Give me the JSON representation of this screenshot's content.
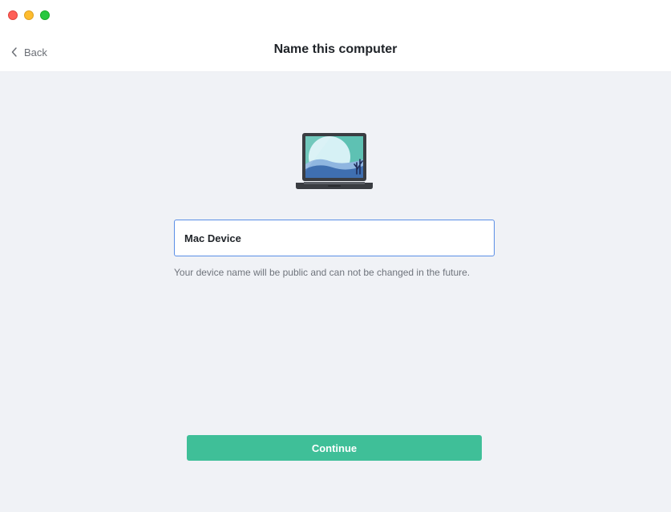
{
  "window": {
    "title": "Name this computer",
    "traffic_lights": [
      "close",
      "minimize",
      "zoom"
    ]
  },
  "nav": {
    "back_label": "Back",
    "back_icon": "chevron-left-icon"
  },
  "illustration": {
    "icon": "laptop-illustration",
    "colors": {
      "body": "#3a3d42",
      "screen": "#5ec1b3",
      "hills": "#3f6fb0",
      "sun": "#d6f1f5"
    }
  },
  "form": {
    "device_name_value": "Mac Device",
    "hint": "Your device name will be public and can not be changed in the future."
  },
  "actions": {
    "continue_label": "Continue"
  },
  "colors": {
    "accent": "#3fbf98",
    "input_focus_border": "#5a8ee6",
    "background": "#f0f2f6"
  }
}
